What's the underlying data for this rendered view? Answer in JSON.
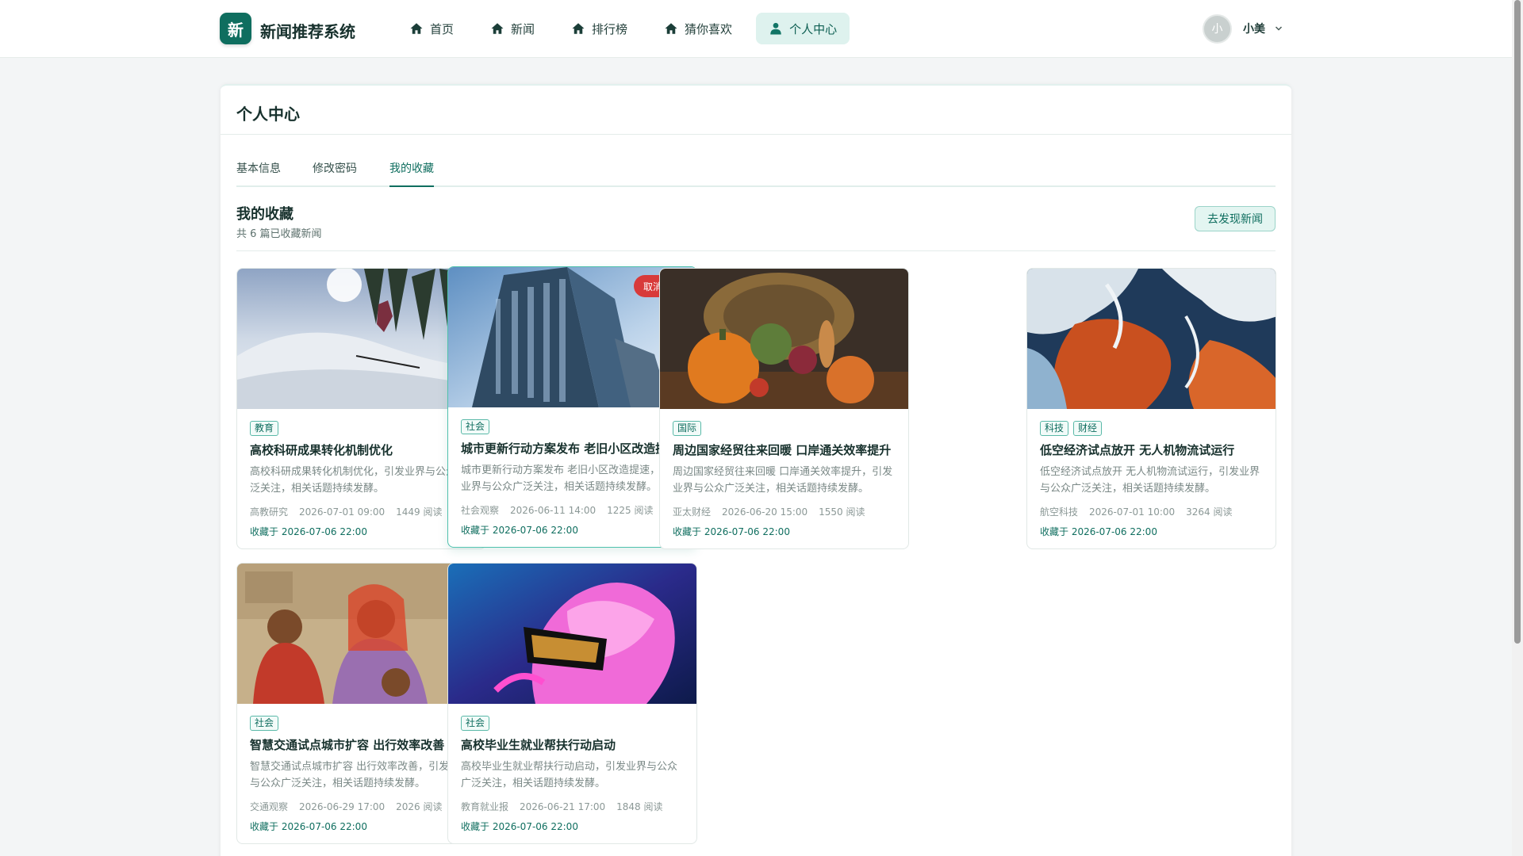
{
  "app": {
    "logo_char": "新",
    "title": "新闻推荐系统"
  },
  "nav": [
    {
      "label": "首页",
      "icon": "home-icon",
      "active": false
    },
    {
      "label": "新闻",
      "icon": "home-icon",
      "active": false
    },
    {
      "label": "排行榜",
      "icon": "home-icon",
      "active": false
    },
    {
      "label": "猜你喜欢",
      "icon": "home-icon",
      "active": false
    },
    {
      "label": "个人中心",
      "icon": "user-icon",
      "active": true
    }
  ],
  "user": {
    "avatar_char": "小",
    "name": "小美"
  },
  "panel": {
    "title": "个人中心"
  },
  "tabs": [
    {
      "label": "基本信息",
      "active": false
    },
    {
      "label": "修改密码",
      "active": false
    },
    {
      "label": "我的收藏",
      "active": true
    }
  ],
  "favorites": {
    "title": "我的收藏",
    "count_text": "共 6 篇已收藏新闻",
    "discover_label": "去发现新闻",
    "unfavorite_label": "取消收藏",
    "items": [
      {
        "tags": [
          "教育"
        ],
        "title": "高校科研成果转化机制优化",
        "summary": "高校科研成果转化机制优化，引发业界与公众广泛关注，相关话题持续发酵。",
        "source": "高教研究",
        "date": "2026-07-01 09:00",
        "reads": "1449 阅读",
        "fav": "收藏于 2026-07-06 22:00"
      },
      {
        "tags": [
          "社会"
        ],
        "title": "城市更新行动方案发布 老旧小区改造提速",
        "summary": "城市更新行动方案发布 老旧小区改造提速，引发业界与公众广泛关注，相关话题持续发酵。",
        "source": "社会观察",
        "date": "2026-06-11 14:00",
        "reads": "1225 阅读",
        "fav": "收藏于 2026-07-06 22:00"
      },
      {
        "tags": [
          "国际"
        ],
        "title": "周边国家经贸往来回暖 口岸通关效率提升",
        "summary": "周边国家经贸往来回暖 口岸通关效率提升，引发业界与公众广泛关注，相关话题持续发酵。",
        "source": "亚太财经",
        "date": "2026-06-20 15:00",
        "reads": "1550 阅读",
        "fav": "收藏于 2026-07-06 22:00"
      },
      {
        "tags": [
          "科技",
          "财经"
        ],
        "title": "低空经济试点放开 无人机物流试运行",
        "summary": "低空经济试点放开 无人机物流试运行，引发业界与公众广泛关注，相关话题持续发酵。",
        "source": "航空科技",
        "date": "2026-07-01 10:00",
        "reads": "3264 阅读",
        "fav": "收藏于 2026-07-06 22:00"
      },
      {
        "tags": [
          "社会"
        ],
        "title": "智慧交通试点城市扩容 出行效率改善",
        "summary": "智慧交通试点城市扩容 出行效率改善，引发业界与公众广泛关注，相关话题持续发酵。",
        "source": "交通观察",
        "date": "2026-06-29 17:00",
        "reads": "2026 阅读",
        "fav": "收藏于 2026-07-06 22:00"
      },
      {
        "tags": [
          "社会"
        ],
        "title": "高校毕业生就业帮扶行动启动",
        "summary": "高校毕业生就业帮扶行动启动，引发业界与公众广泛关注，相关话题持续发酵。",
        "source": "教育就业报",
        "date": "2026-06-21 17:00",
        "reads": "1848 阅读",
        "fav": "收藏于 2026-07-06 22:00"
      }
    ]
  },
  "colors": {
    "brand": "#0f6e5f",
    "danger": "#d83a3a",
    "active_nav_bg": "#def2ee"
  }
}
